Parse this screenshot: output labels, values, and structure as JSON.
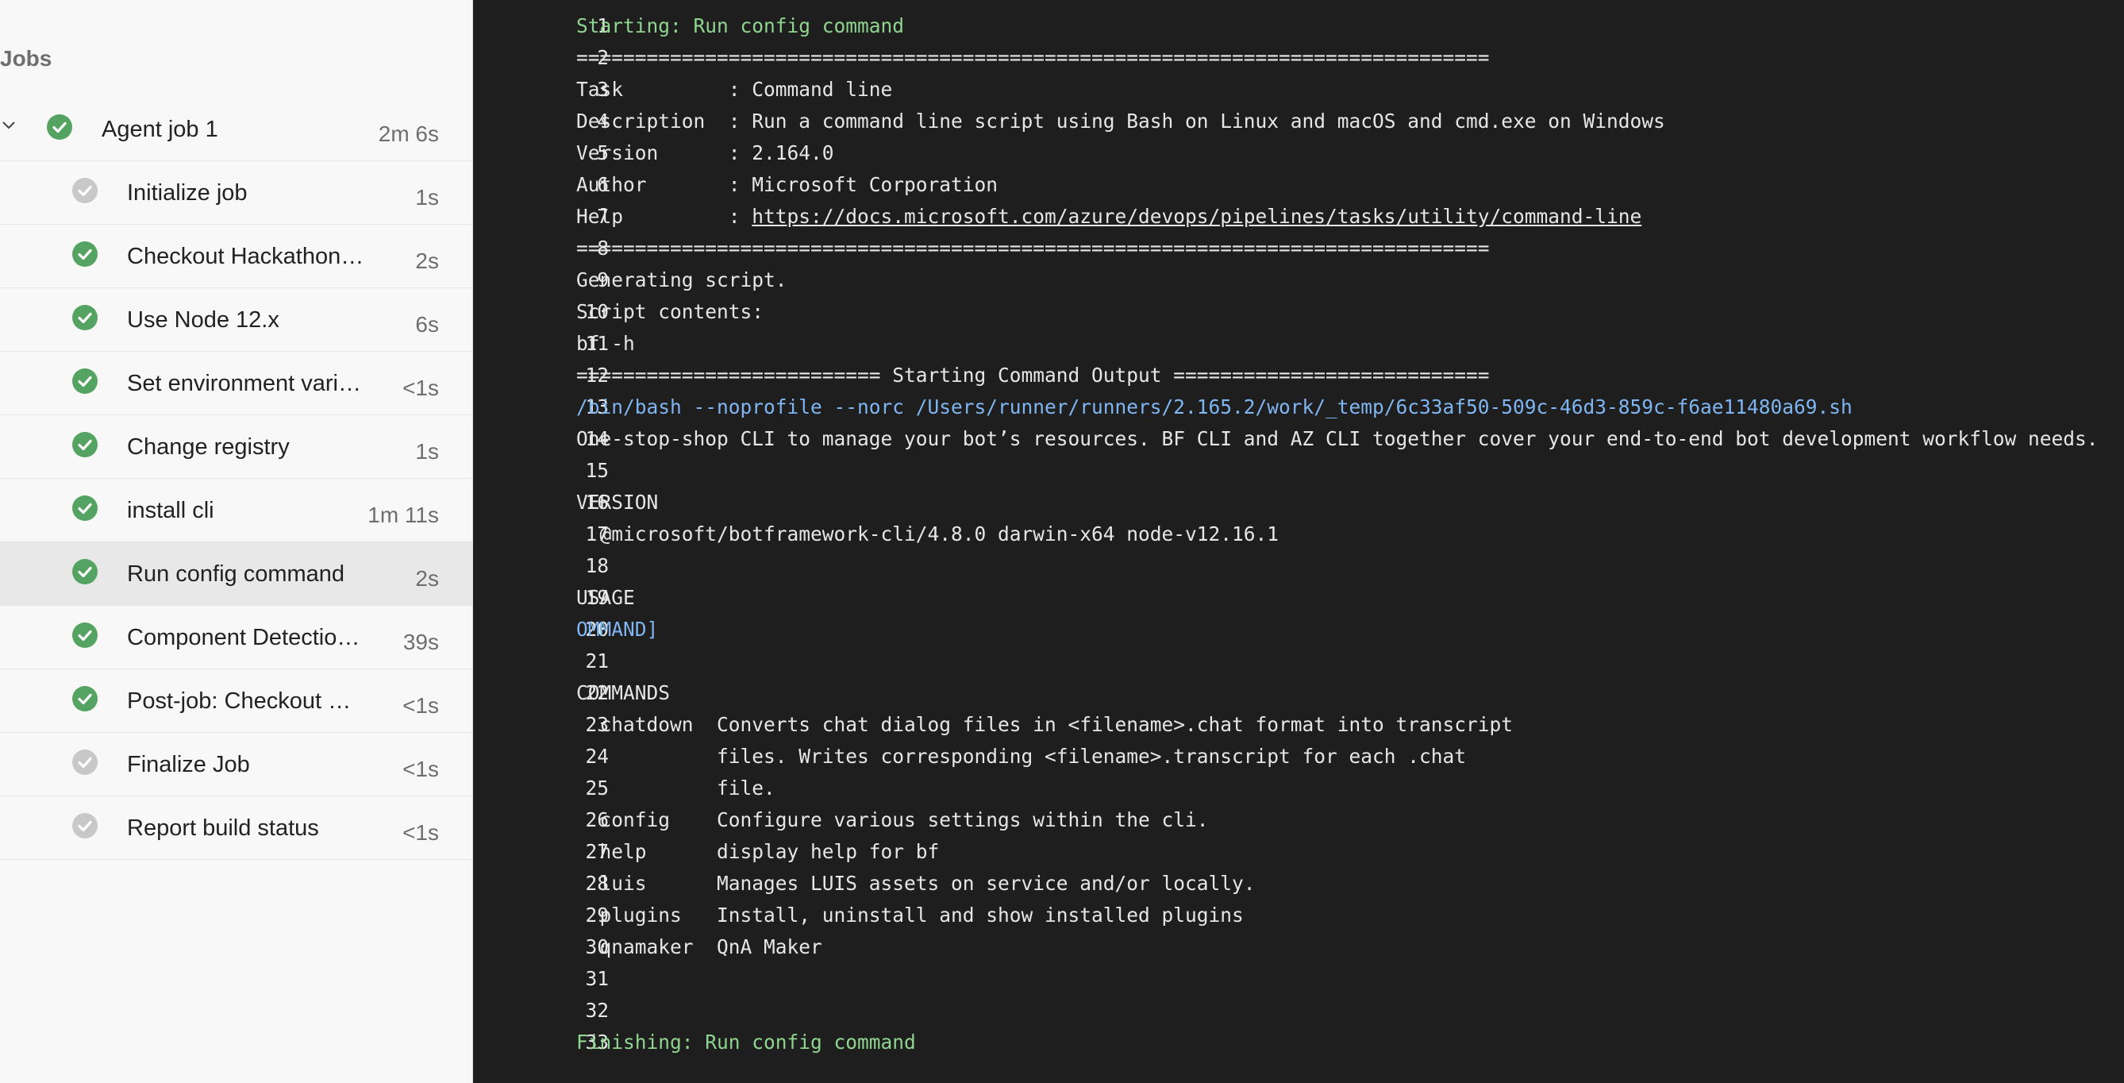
{
  "sidebar": {
    "heading": "Jobs",
    "job": {
      "label": "Agent job 1",
      "duration": "2m 6s",
      "status": "success"
    },
    "steps": [
      {
        "label": "Initialize job",
        "duration": "1s",
        "status": "skipped"
      },
      {
        "label": "Checkout Hackathon…",
        "duration": "2s",
        "status": "success"
      },
      {
        "label": "Use Node 12.x",
        "duration": "6s",
        "status": "success"
      },
      {
        "label": "Set environment vari…",
        "duration": "<1s",
        "status": "success"
      },
      {
        "label": "Change registry",
        "duration": "1s",
        "status": "success"
      },
      {
        "label": "install cli",
        "duration": "1m 11s",
        "status": "success"
      },
      {
        "label": "Run config command",
        "duration": "2s",
        "status": "success",
        "selected": true
      },
      {
        "label": "Component Detectio…",
        "duration": "39s",
        "status": "success"
      },
      {
        "label": "Post-job: Checkout …",
        "duration": "<1s",
        "status": "success"
      },
      {
        "label": "Finalize Job",
        "duration": "<1s",
        "status": "skipped"
      },
      {
        "label": "Report build status",
        "duration": "<1s",
        "status": "skipped"
      }
    ]
  },
  "colors": {
    "success": "#55a362",
    "skipped": "#c8c8c8",
    "console_bg": "#1e1e1e",
    "section_text": "#8fd48f",
    "command_text": "#7fb5f0"
  },
  "log": {
    "lines": [
      {
        "num": "1",
        "text": "Starting: Run config command",
        "style": "green"
      },
      {
        "num": "2",
        "text": "==============================================================================",
        "style": ""
      },
      {
        "num": "3",
        "text": "Task         : Command line",
        "style": ""
      },
      {
        "num": "4",
        "text": "Description  : Run a command line script using Bash on Linux and macOS and cmd.exe on Windows",
        "style": ""
      },
      {
        "num": "5",
        "text": "Version      : 2.164.0",
        "style": ""
      },
      {
        "num": "6",
        "text": "Author       : Microsoft Corporation",
        "style": ""
      },
      {
        "num": "7",
        "text": "Help         : ",
        "link": "https://docs.microsoft.com/azure/devops/pipelines/tasks/utility/command-line",
        "style": ""
      },
      {
        "num": "8",
        "text": "==============================================================================",
        "style": ""
      },
      {
        "num": "9",
        "text": "Generating script.",
        "style": ""
      },
      {
        "num": "10",
        "text": "Script contents:",
        "style": ""
      },
      {
        "num": "11",
        "text": "bf -h",
        "style": ""
      },
      {
        "num": "12",
        "text": "========================== Starting Command Output ===========================",
        "style": ""
      },
      {
        "num": "13",
        "text": "/bin/bash --noprofile --norc /Users/runner/runners/2.165.2/work/_temp/6c33af50-509c-46d3-859c-f6ae11480a69.sh",
        "style": "blue"
      },
      {
        "num": "14",
        "text": "One-stop-shop CLI to manage your bot’s resources. BF CLI and AZ CLI together cover your end-to-end bot development workflow needs.",
        "style": ""
      },
      {
        "num": "15",
        "text": "",
        "style": ""
      },
      {
        "num": "16",
        "text": "VERSION",
        "style": ""
      },
      {
        "num": "17",
        "text": "  @microsoft/botframework-cli/4.8.0 darwin-x64 node-v12.16.1",
        "style": ""
      },
      {
        "num": "18",
        "text": "",
        "style": ""
      },
      {
        "num": "19",
        "text": "USAGE",
        "style": ""
      },
      {
        "num": "20",
        "text": "OMMAND]",
        "style": "blue"
      },
      {
        "num": "21",
        "text": "",
        "style": ""
      },
      {
        "num": "22",
        "text": "COMMANDS",
        "style": ""
      },
      {
        "num": "23",
        "text": "  chatdown  Converts chat dialog files in <filename>.chat format into transcript",
        "style": ""
      },
      {
        "num": "24",
        "text": "            files. Writes corresponding <filename>.transcript for each .chat",
        "style": ""
      },
      {
        "num": "25",
        "text": "            file.",
        "style": ""
      },
      {
        "num": "26",
        "text": "  config    Configure various settings within the cli.",
        "style": ""
      },
      {
        "num": "27",
        "text": "  help      display help for bf",
        "style": ""
      },
      {
        "num": "28",
        "text": "  luis      Manages LUIS assets on service and/or locally.",
        "style": ""
      },
      {
        "num": "29",
        "text": "  plugins   Install, uninstall and show installed plugins",
        "style": ""
      },
      {
        "num": "30",
        "text": "  qnamaker  QnA Maker",
        "style": ""
      },
      {
        "num": "31",
        "text": "",
        "style": ""
      },
      {
        "num": "32",
        "text": "",
        "style": ""
      },
      {
        "num": "33",
        "text": "Finishing: Run config command",
        "style": "green"
      }
    ]
  }
}
